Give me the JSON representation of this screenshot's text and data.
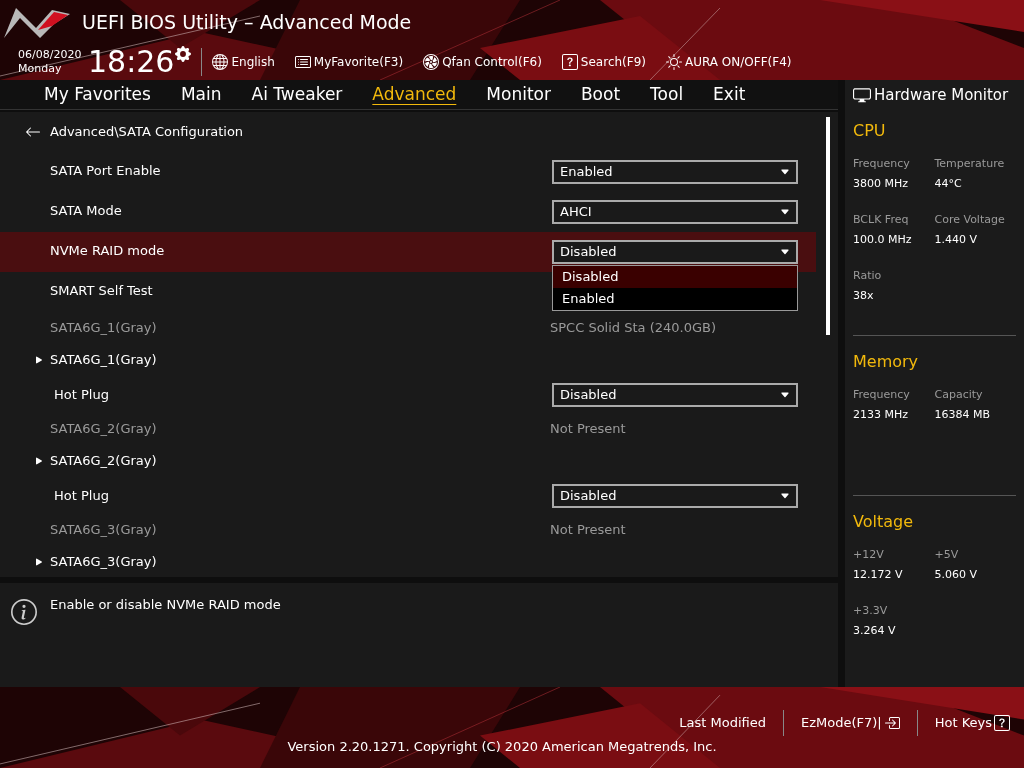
{
  "header": {
    "title": "UEFI BIOS Utility – Advanced Mode",
    "date": "06/08/2020",
    "weekday": "Monday",
    "time": "18:26",
    "toolbar": [
      {
        "kind": "language",
        "label": "English"
      },
      {
        "kind": "favorite",
        "label": "MyFavorite(F3)"
      },
      {
        "kind": "fan",
        "label": "Qfan Control(F6)"
      },
      {
        "kind": "search",
        "label": "Search(F9)"
      },
      {
        "kind": "aura",
        "label": "AURA ON/OFF(F4)"
      }
    ]
  },
  "tabs": [
    {
      "label": "My Favorites",
      "selected": false
    },
    {
      "label": "Main",
      "selected": false
    },
    {
      "label": "Ai Tweaker",
      "selected": false
    },
    {
      "label": "Advanced",
      "selected": true
    },
    {
      "label": "Monitor",
      "selected": false
    },
    {
      "label": "Boot",
      "selected": false
    },
    {
      "label": "Tool",
      "selected": false
    },
    {
      "label": "Exit",
      "selected": false
    }
  ],
  "breadcrumb": "Advanced\\SATA Configuration",
  "rows": [
    {
      "kind": "dropdown",
      "label": "SATA Port Enable",
      "value": "Enabled",
      "selected": false
    },
    {
      "kind": "dropdown",
      "label": "SATA Mode",
      "value": "AHCI",
      "selected": false
    },
    {
      "kind": "dropdown",
      "label": "NVMe RAID mode",
      "value": "Disabled",
      "selected": true
    },
    {
      "kind": "dropdown",
      "label": "SMART Self Test",
      "selected": false
    },
    {
      "kind": "info",
      "label": "SATA6G_1(Gray)",
      "value": "SPCC Solid Sta (240.0GB)",
      "selected": false
    },
    {
      "kind": "submenu",
      "label": "SATA6G_1(Gray)",
      "selected": false
    },
    {
      "kind": "subsetting",
      "label": "Hot Plug",
      "value": "Disabled",
      "selected": false
    },
    {
      "kind": "info",
      "label": "SATA6G_2(Gray)",
      "value": "Not Present",
      "selected": false
    },
    {
      "kind": "submenu",
      "label": "SATA6G_2(Gray)",
      "selected": false
    },
    {
      "kind": "subsetting",
      "label": "Hot Plug",
      "value": "Disabled",
      "selected": false
    },
    {
      "kind": "info",
      "label": "SATA6G_3(Gray)",
      "value": "Not Present",
      "selected": false
    },
    {
      "kind": "submenu",
      "label": "SATA6G_3(Gray)",
      "selected": false
    }
  ],
  "dropdown_menu": {
    "options": [
      {
        "label": "Disabled",
        "selected": true
      },
      {
        "label": "Enabled",
        "selected": false
      }
    ]
  },
  "help": "Enable or disable NVMe RAID mode",
  "hardware_monitor": {
    "title": "Hardware Monitor",
    "sections": [
      {
        "title": "CPU",
        "items": [
          {
            "label": "Frequency",
            "value": "3800 MHz"
          },
          {
            "label": "Temperature",
            "value": "44°C"
          },
          {
            "label": "BCLK Freq",
            "value": "100.0 MHz"
          },
          {
            "label": "Core Voltage",
            "value": "1.440 V"
          },
          {
            "label": "Ratio",
            "value": "38x"
          }
        ]
      },
      {
        "title": "Memory",
        "items": [
          {
            "label": "Frequency",
            "value": "2133 MHz"
          },
          {
            "label": "Capacity",
            "value": "16384 MB"
          }
        ]
      },
      {
        "title": "Voltage",
        "items": [
          {
            "label": "+12V",
            "value": "12.172 V"
          },
          {
            "label": "+5V",
            "value": "5.060 V"
          },
          {
            "label": "+3.3V",
            "value": "3.264 V"
          }
        ]
      }
    ]
  },
  "footer": {
    "buttons": [
      {
        "kind": "plain",
        "label": "Last Modified"
      },
      {
        "kind": "ezmode",
        "label": "EzMode(F7)|"
      },
      {
        "kind": "hotkeys",
        "label": "Hot Keys"
      }
    ],
    "copyright": "Version 2.20.1271. Copyright (C) 2020 American Megatrends, Inc."
  }
}
